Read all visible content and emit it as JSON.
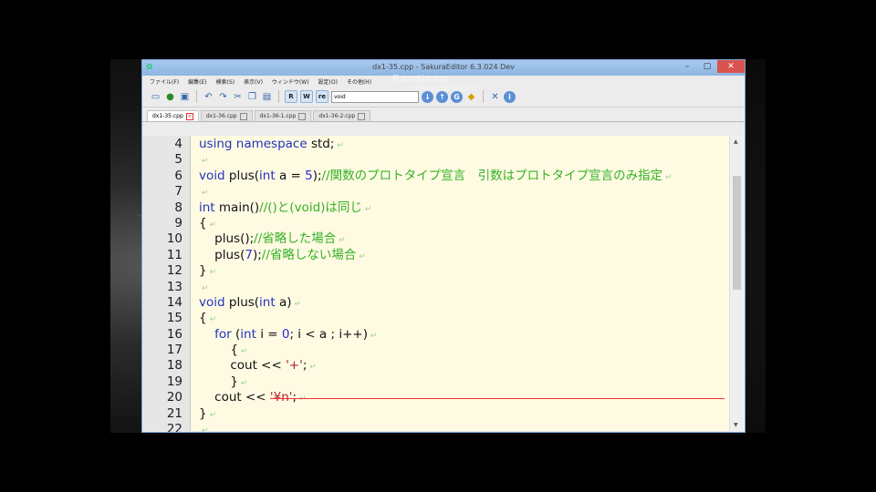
{
  "window": {
    "title": "dx1-35.cpp - SakuraEditor 6.3.024 Dev",
    "watermark": "Bandicam",
    "watermark_sub": "www.bandicam.com"
  },
  "menu": [
    "ファイル(F)",
    "編集(E)",
    "検索(S)",
    "表示(V)",
    "ウィンドウ(W)",
    "設定(O)",
    "その他(H)"
  ],
  "toolbar": {
    "toggle_1": "R",
    "toggle_2": "W",
    "toggle_3": "re",
    "search_value": "void"
  },
  "tabs": [
    {
      "label": "dx1-35.cpp",
      "active": true
    },
    {
      "label": "dx1-36.cpp",
      "active": false
    },
    {
      "label": "dx1-36-1.cpp",
      "active": false
    },
    {
      "label": "dx1-36-2.cpp",
      "active": false
    }
  ],
  "editor": {
    "lines": [
      {
        "n": "4",
        "code": [
          [
            "kw",
            "using namespace"
          ],
          [
            "t",
            " std;"
          ]
        ]
      },
      {
        "n": "5",
        "code": []
      },
      {
        "n": "6",
        "code": [
          [
            "kw",
            "void"
          ],
          [
            "t",
            " plus("
          ],
          [
            "kw",
            "int"
          ],
          [
            "t",
            " a = "
          ],
          [
            "num",
            "5"
          ],
          [
            "t",
            ");"
          ],
          [
            "cm",
            "//関数のプロトタイプ宣言　引数はプロトタイプ宣言のみ指定"
          ]
        ]
      },
      {
        "n": "7",
        "code": []
      },
      {
        "n": "8",
        "code": [
          [
            "kw",
            "int"
          ],
          [
            "t",
            " main()"
          ],
          [
            "cm",
            "//()と(void)は同じ"
          ]
        ]
      },
      {
        "n": "9",
        "code": [
          [
            "t",
            "{"
          ]
        ]
      },
      {
        "n": "10",
        "code": [
          [
            "t",
            "    plus();"
          ],
          [
            "cm",
            "//省略した場合"
          ]
        ]
      },
      {
        "n": "11",
        "code": [
          [
            "t",
            "    plus("
          ],
          [
            "num",
            "7"
          ],
          [
            "t",
            ");"
          ],
          [
            "cm",
            "//省略しない場合"
          ]
        ]
      },
      {
        "n": "12",
        "code": [
          [
            "t",
            "}"
          ]
        ]
      },
      {
        "n": "13",
        "code": []
      },
      {
        "n": "14",
        "code": [
          [
            "kw",
            "void"
          ],
          [
            "t",
            " plus("
          ],
          [
            "kw",
            "int"
          ],
          [
            "t",
            " a)"
          ]
        ]
      },
      {
        "n": "15",
        "code": [
          [
            "t",
            "{"
          ]
        ]
      },
      {
        "n": "16",
        "code": [
          [
            "t",
            "    "
          ],
          [
            "kw",
            "for"
          ],
          [
            "t",
            " ("
          ],
          [
            "kw",
            "int"
          ],
          [
            "t",
            " i = "
          ],
          [
            "num",
            "0"
          ],
          [
            "t",
            "; i < a ; i++)"
          ]
        ]
      },
      {
        "n": "17",
        "code": [
          [
            "t",
            "        {"
          ]
        ]
      },
      {
        "n": "18",
        "code": [
          [
            "t",
            "        cout << "
          ],
          [
            "str",
            "'+'"
          ],
          [
            "t",
            ";"
          ]
        ]
      },
      {
        "n": "19",
        "code": [
          [
            "t",
            "        }"
          ]
        ]
      },
      {
        "n": "20",
        "code": [
          [
            "t",
            "    cout << "
          ],
          [
            "str",
            "'¥n'"
          ],
          [
            "t",
            ";"
          ]
        ],
        "cursor": true
      },
      {
        "n": "21",
        "code": [
          [
            "t",
            "}"
          ]
        ]
      },
      {
        "n": "22",
        "code": []
      }
    ]
  },
  "colors": {
    "keyword": "#2233bb",
    "comment": "#35b025",
    "number": "#2a2ad8",
    "string": "#b02233",
    "editor_bg": "#fffbe3",
    "cursor_line": "#ef3333"
  }
}
